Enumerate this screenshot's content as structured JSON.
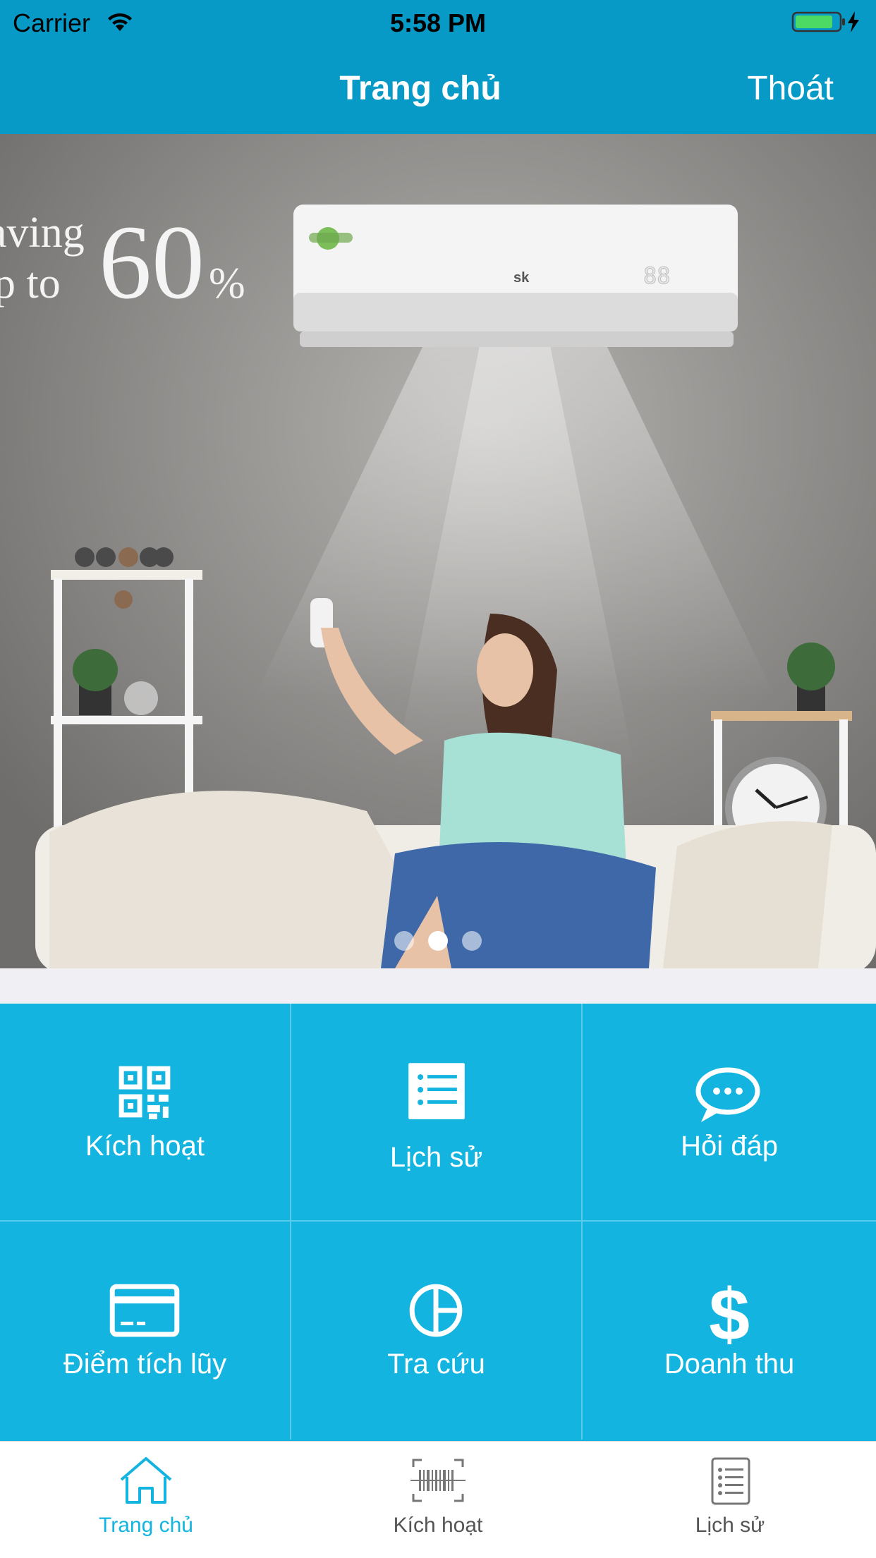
{
  "status_bar": {
    "carrier": "Carrier",
    "time": "5:58 PM",
    "icons": [
      "wifi-icon",
      "battery-icon",
      "charging-bolt-icon"
    ]
  },
  "nav": {
    "title": "Trang chủ",
    "right_button": "Thoát"
  },
  "banner": {
    "promo_line_1": "aving",
    "promo_line_2": "up to",
    "promo_percent": "60",
    "promo_percent_sign": "%",
    "ac_brand": "sk",
    "ac_display": "88",
    "carousel_page_count": 3,
    "carousel_active_index": 1
  },
  "menu": [
    {
      "label": "Kích hoạt",
      "icon": "qr-code-icon"
    },
    {
      "label": "Lịch sử",
      "icon": "list-icon"
    },
    {
      "label": "Hỏi đáp",
      "icon": "chat-bubble-icon"
    },
    {
      "label": "Điểm tích lũy",
      "icon": "credit-card-icon"
    },
    {
      "label": "Tra cứu",
      "icon": "pie-chart-icon"
    },
    {
      "label": "Doanh thu",
      "icon": "dollar-icon"
    }
  ],
  "tabs": [
    {
      "label": "Trang chủ",
      "icon": "home-icon",
      "active": true
    },
    {
      "label": "Kích hoạt",
      "icon": "barcode-scan-icon",
      "active": false
    },
    {
      "label": "Lịch sử",
      "icon": "document-list-icon",
      "active": false
    }
  ],
  "colors": {
    "bar_blue": "#089ac6",
    "tile_blue": "#13b5e0",
    "tab_active": "#13b5e0",
    "tab_inactive": "#555555"
  }
}
